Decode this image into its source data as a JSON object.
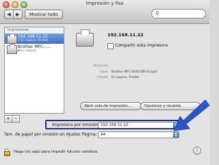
{
  "window": {
    "title": "Impresión y Fax"
  },
  "toolbar": {
    "back": "◀",
    "forward": "▶",
    "show_all": "Mostrar todo"
  },
  "printers": {
    "header": "Impresoras",
    "items": [
      {
        "name": "192.168.11.22",
        "status": "• En espera, Predet."
      },
      {
        "name": "Brother MFC-.....",
        "status": "En espera"
      }
    ],
    "add": "+",
    "remove": "−"
  },
  "detail": {
    "name": "192.168.11.22",
    "share_label": "Compartir esta impresora",
    "location_label": "Ubicación:",
    "location_value": "",
    "kind_label": "Clase:",
    "kind_value": "Brother MFC-XXXX BR-Script3",
    "status_label": "Estado:",
    "status_value": "En espera, Predet.",
    "open_queue": "Abrir cola de impresión...",
    "options": "Opciones y recamb"
  },
  "settings": {
    "default_printer_label": "Impresora por omisión:",
    "default_printer_value": "192.168.11.22",
    "paper_label": "Tam. de papel por omisión en Ajustar Página:",
    "paper_value": "A4"
  },
  "footer": {
    "lock_text": "Haga clic aquí para impedir futuros cambios.",
    "help": "?"
  },
  "colors": {
    "selection": "#3f73c9",
    "annotation_arrow": "#2b55c9",
    "highlight_box": "#1b2f7c"
  }
}
